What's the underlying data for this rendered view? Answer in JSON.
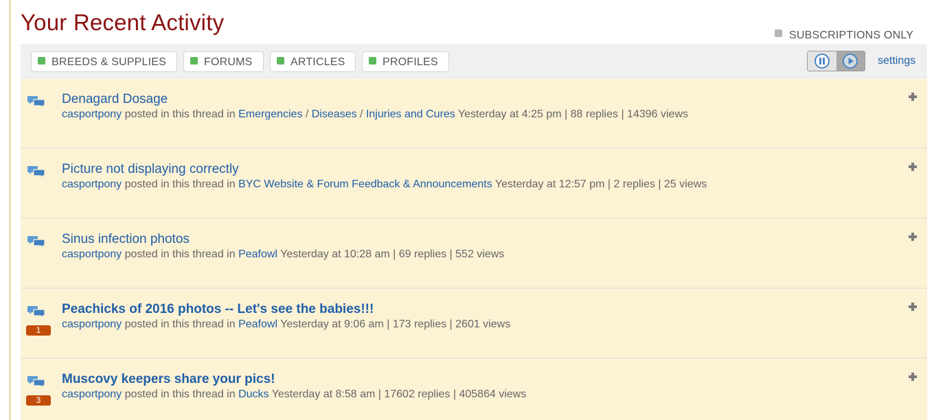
{
  "page_title": "Your Recent Activity",
  "subscriptions_only_label": "SUBSCRIPTIONS ONLY",
  "filters": [
    {
      "label": "BREEDS & SUPPLIES"
    },
    {
      "label": "FORUMS"
    },
    {
      "label": "ARTICLES"
    },
    {
      "label": "PROFILES"
    }
  ],
  "settings_label": "settings",
  "posted_phrase": "posted in this thread in",
  "colors": {
    "title": "#8b1212",
    "link": "#1f5fa8",
    "filter_on": "#5cb85c",
    "item_bg": "#fcf2d4",
    "badge": "#c24d0a"
  },
  "items": [
    {
      "title": "Denagard Dosage",
      "bold": false,
      "badge": null,
      "user": "casportpony",
      "forum": "Emergencies / Diseases / Injuries and Cures",
      "time": "Yesterday at 4:25 pm",
      "replies": "88 replies",
      "views": "14396 views"
    },
    {
      "title": "Picture not displaying correctly",
      "bold": false,
      "badge": null,
      "user": "casportpony",
      "forum": "BYC Website & Forum Feedback & Announcements",
      "time": "Yesterday at 12:57 pm",
      "replies": "2 replies",
      "views": "25 views"
    },
    {
      "title": "Sinus infection photos",
      "bold": false,
      "badge": null,
      "user": "casportpony",
      "forum": "Peafowl",
      "time": "Yesterday at 10:28 am",
      "replies": "69 replies",
      "views": "552 views"
    },
    {
      "title": "Peachicks of 2016 photos -- Let's see the babies!!!",
      "bold": true,
      "badge": "1",
      "user": "casportpony",
      "forum": "Peafowl",
      "time": "Yesterday at 9:06 am",
      "replies": "173 replies",
      "views": "2601 views"
    },
    {
      "title": "Muscovy keepers share your pics!",
      "bold": true,
      "badge": "3",
      "user": "casportpony",
      "forum": "Ducks",
      "time": "Yesterday at 8:58 am",
      "replies": "17602 replies",
      "views": "405864 views"
    }
  ]
}
